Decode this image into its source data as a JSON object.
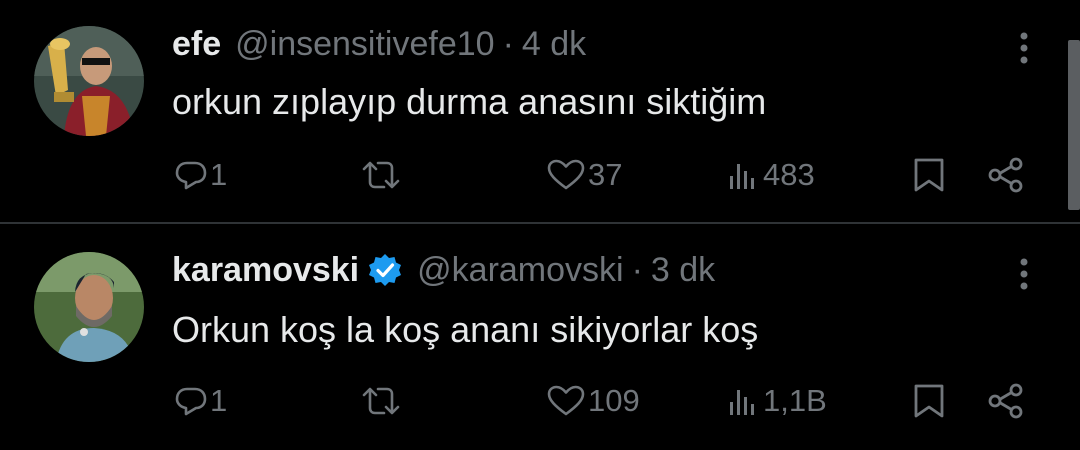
{
  "tweets": [
    {
      "name": "efe",
      "handle": "@insensitivefe10",
      "separator": "·",
      "time": "4 dk",
      "verified": false,
      "text": "orkun zıplayıp durma anasını siktiğim",
      "reply_count": "1",
      "retweet_count": "",
      "like_count": "37",
      "view_count": "483"
    },
    {
      "name": "karamovski",
      "handle": "@karamovski",
      "separator": "·",
      "time": "3 dk",
      "verified": true,
      "text": "Orkun koş la koş ananı sikiyorlar koş",
      "reply_count": "1",
      "retweet_count": "",
      "like_count": "109",
      "view_count": "1,1B"
    }
  ],
  "icons": {
    "reply": "reply-icon",
    "retweet": "retweet-icon",
    "like": "heart-icon",
    "views": "views-icon",
    "bookmark": "bookmark-icon",
    "share": "share-icon",
    "more": "more-vertical-icon",
    "verified": "verified-badge-icon"
  },
  "colors": {
    "background": "#000000",
    "text": "#e7e9ea",
    "muted": "#71767b",
    "divider": "#2f3336",
    "verified": "#1d9bf0"
  }
}
